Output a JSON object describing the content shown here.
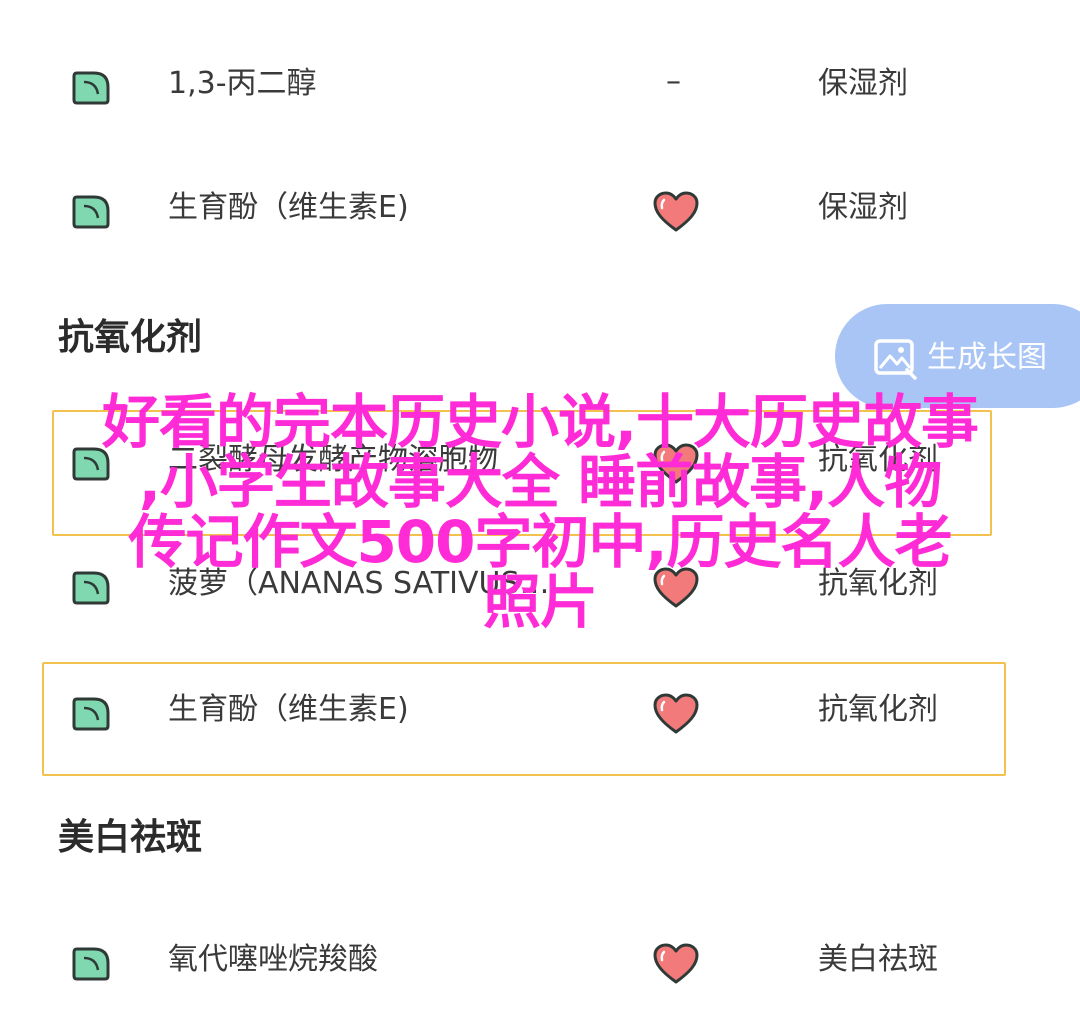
{
  "rows": [
    {
      "name": "1,3-丙二醇",
      "rating": "–",
      "function": "保湿剂"
    },
    {
      "name": "生育酚（维生素E)",
      "rating": "heart",
      "function": "保湿剂"
    },
    {
      "name": "二裂酵母发酵产物溶胞物",
      "rating": "heart",
      "function": "抗氧化剂"
    },
    {
      "name": "菠萝（ANANAS SATIVUS…",
      "rating": "heart",
      "function": "抗氧化剂"
    },
    {
      "name": "生育酚（维生素E)",
      "rating": "heart",
      "function": "抗氧化剂"
    },
    {
      "name": "氧代噻唑烷羧酸",
      "rating": "heart",
      "function": "美白祛斑"
    }
  ],
  "sections": {
    "antioxidant": "抗氧化剂",
    "whitening": "美白祛斑"
  },
  "generate_button": {
    "label": "生成长图",
    "icon": "image-icon"
  },
  "overlay": {
    "line1": "好看的完本历史小说,十大历史故事",
    "line2": ",小学生故事大全 睡前故事,人物",
    "line3": "传记作文500字初中,历史名人老",
    "line4": "照片"
  },
  "colors": {
    "leaf_fill": "#7fd8b0",
    "leaf_stroke": "#2f3a36",
    "heart_fill": "#f27a7a",
    "heart_stroke": "#2f3a36",
    "highlight_border": "#f2c14e",
    "pill_bg": "#a9c5f5",
    "overlay_text": "#ff2bd6"
  }
}
